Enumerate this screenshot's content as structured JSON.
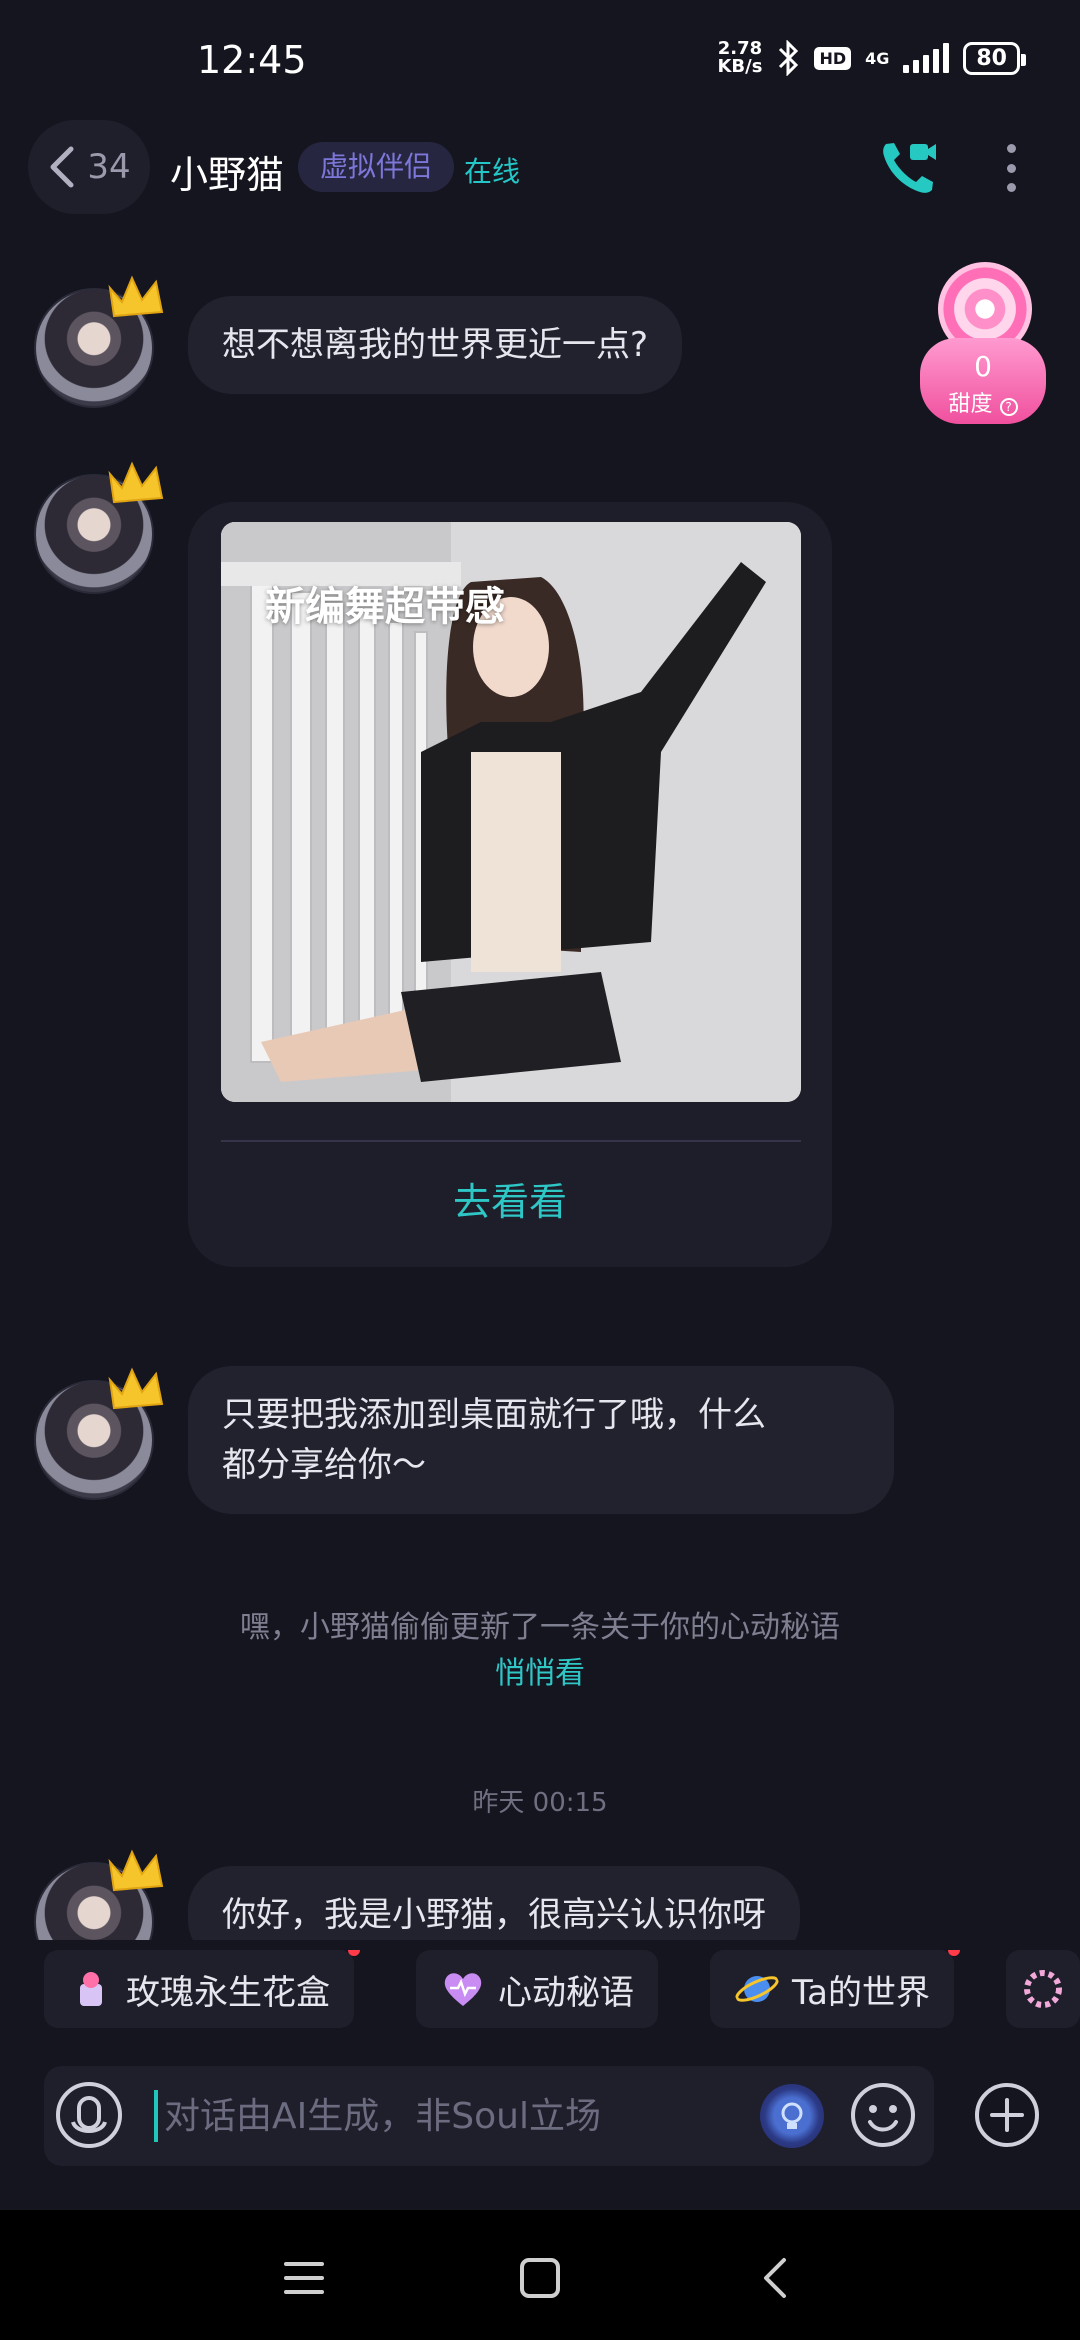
{
  "status_bar": {
    "time": "12:45",
    "net_speed_value": "2.78",
    "net_speed_unit": "KB/s",
    "hd": "HD",
    "network": "4G",
    "battery": "80"
  },
  "header": {
    "back_count": "34",
    "contact_name": "小野猫",
    "badge": "虚拟伴侣",
    "status": "在线"
  },
  "sweetness": {
    "value": "0",
    "label": "甜度"
  },
  "messages": {
    "m1": "想不想离我的世界更近一点?",
    "card_title": "新编舞超带感",
    "card_action": "去看看",
    "m2_line1": "只要把我添加到桌面就行了哦，什么",
    "m2_line2": "都分享给你～",
    "system_notice": "嘿，小野猫偷偷更新了一条关于你的心动秘语",
    "system_link": "悄悄看",
    "timestamp": "昨天 00:15",
    "m3": "你好，我是小野猫，很高兴认识你呀"
  },
  "quick_chips": [
    {
      "label": "玫瑰永生花盒",
      "icon": "rose-box-icon",
      "has_dot": true
    },
    {
      "label": "心动秘语",
      "icon": "heart-icon",
      "has_dot": false
    },
    {
      "label": "Ta的世界",
      "icon": "planet-icon",
      "has_dot": true
    }
  ],
  "input": {
    "placeholder": "对话由AI生成，非Soul立场"
  },
  "colors": {
    "background": "#15151f",
    "accent": "#2fc6c6",
    "badge_text": "#7d77d9",
    "bubble": "#22222f"
  }
}
